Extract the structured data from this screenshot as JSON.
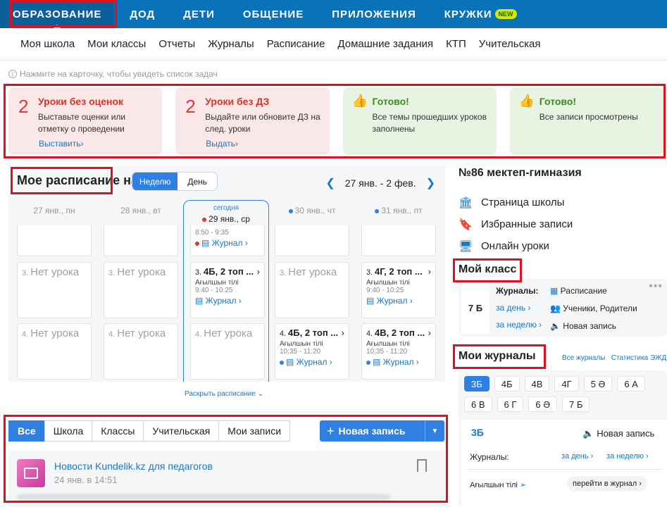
{
  "topnav": {
    "items": [
      "ОБРАЗОВАНИЕ",
      "ДОД",
      "ДЕТИ",
      "ОБЩЕНИЕ",
      "ПРИЛОЖЕНИЯ",
      "КРУЖКИ"
    ],
    "new_badge": "NEW"
  },
  "subnav": {
    "items": [
      "Моя школа",
      "Мои классы",
      "Отчеты",
      "Журналы",
      "Расписание",
      "Домашние задания",
      "КТП",
      "Учительская"
    ]
  },
  "hint": "Нажмите на карточку, чтобы увидеть список задач",
  "cards": [
    {
      "num": "2",
      "title": "Уроки без оценок",
      "desc": "Выставьте оценки или отметку о проведении",
      "link": "Выставить"
    },
    {
      "num": "2",
      "title": "Уроки без ДЗ",
      "desc": "Выдайте или обновите ДЗ на след. уроки",
      "link": "Выдать"
    },
    {
      "title": "Готово!",
      "desc": "Все темы прошедших уроков заполнены"
    },
    {
      "title": "Готово!",
      "desc": "Все записи просмотрены"
    }
  ],
  "schedule": {
    "title": "Мое расписание на",
    "week_btn": "Неделю",
    "day_btn": "День",
    "range": "27 янв. - 2 фев.",
    "today_label": "сегодня",
    "days": [
      "27 янв., пн",
      "28 янв., вт",
      "29 янв., ср",
      "30 янв., чт",
      "31 янв., пт"
    ],
    "no_lesson": "Нет урока",
    "journal": "Журнал",
    "today_time": "8:50 - 9:35",
    "lessons": {
      "wed3_title": "4Б, 2 топ ...",
      "wed3_sub": "Ағылшын тілі",
      "wed3_time": "9:40 - 10:25",
      "fri3_title": "4Г, 2 топ ...",
      "fri3_sub": "Ағылшын тілі",
      "fri3_time": "9:40 - 10:25",
      "thu4_title": "4Б, 2 топ ...",
      "thu4_sub": "Ағылшын тілі",
      "thu4_time": "10:35 - 11:20",
      "fri4_title": "4В, 2 топ ...",
      "fri4_sub": "Ағылшын тілі",
      "fri4_time": "10:35 - 11:20"
    },
    "expand": "Раскрыть расписание"
  },
  "school": {
    "name": "№86 мектеп-гимназия",
    "links": [
      "Страница школы",
      "Избранные записи",
      "Онлайн уроки"
    ]
  },
  "my_class": {
    "title": "Мой класс",
    "class_name": "7 Б",
    "journals_label": "Журналы:",
    "per_day": "за день",
    "per_week": "за неделю",
    "schedule": "Расписание",
    "students": "Ученики, Родители",
    "new_record": "Новая запись"
  },
  "my_journals": {
    "title": "Мои журналы",
    "all": "Все журналы",
    "stats": "Статистика ЭЖД",
    "chips": [
      "3Б",
      "4Б",
      "4В",
      "4Г",
      "5 Ә",
      "6 А",
      "6 В",
      "6 Г",
      "6 Ә",
      "7 Б"
    ],
    "selected": "3Б",
    "new_record": "Новая запись",
    "journals_label": "Журналы:",
    "per_day": "за день",
    "per_week": "за неделю",
    "subject": "Ағылшын тілі",
    "go": "перейти в журнал"
  },
  "feed": {
    "tabs": [
      "Все",
      "Школа",
      "Классы",
      "Учительская",
      "Мои записи"
    ],
    "new_record": "Новая запись",
    "post_title": "Новости Kundelik.kz для педагогов",
    "post_date": "24 янв. в 14:51"
  }
}
